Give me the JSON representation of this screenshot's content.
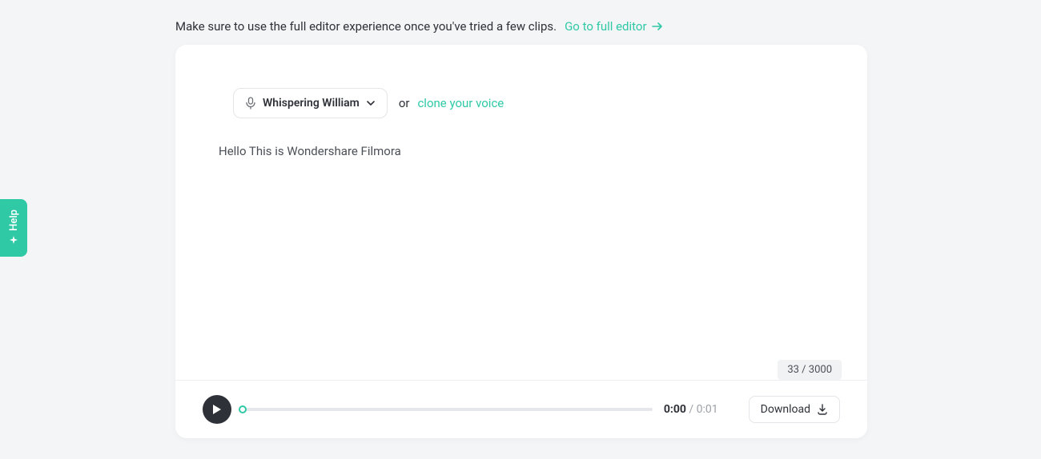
{
  "banner": {
    "message": "Make sure to use the full editor experience once you've tried a few clips.",
    "link_label": "Go to full editor"
  },
  "voice": {
    "selected": "Whispering William",
    "or_label": "or",
    "clone_link": "clone your voice"
  },
  "editor": {
    "text": "Hello This is Wondershare Filmora",
    "counter": "33 / 3000"
  },
  "player": {
    "current": "0:00",
    "duration": "0:01",
    "download_label": "Download"
  },
  "help": {
    "label": "Help"
  },
  "colors": {
    "accent": "#2fc9a6",
    "dark": "#2e3138",
    "bg": "#f4f5f7"
  }
}
